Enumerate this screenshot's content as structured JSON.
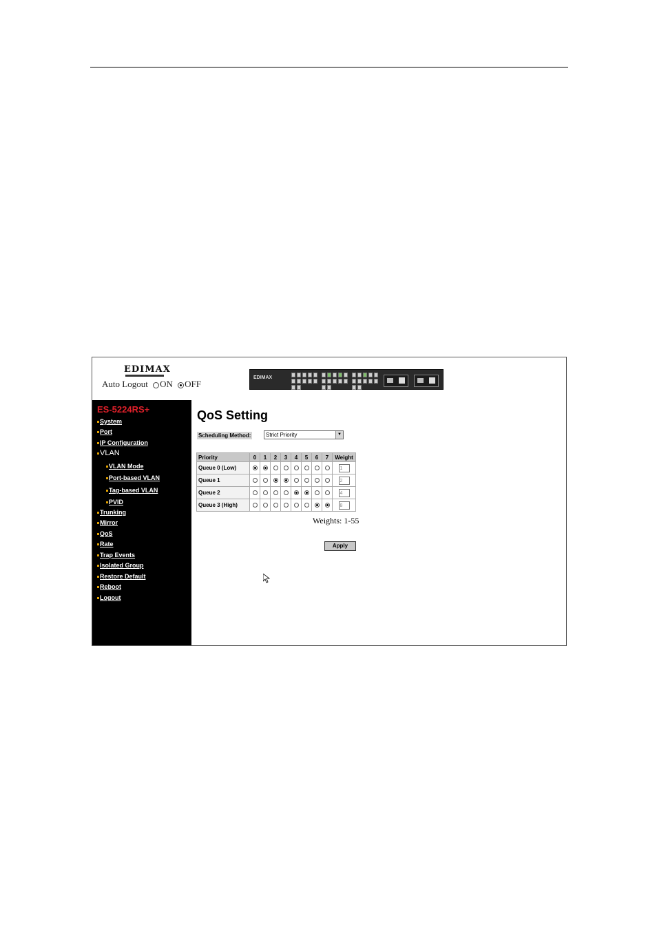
{
  "header": {
    "logo_text": "EDIMAX",
    "auto_logout_label": "Auto Logout",
    "auto_logout_on": "ON",
    "auto_logout_off": "OFF",
    "auto_logout_selected": "OFF",
    "switch_brand": "EDIMAX"
  },
  "sidebar": {
    "model": "ES-5224RS+",
    "items": [
      {
        "label": "System"
      },
      {
        "label": "Port"
      },
      {
        "label": "IP Configuration"
      },
      {
        "label": "VLAN"
      },
      {
        "label": "VLAN Mode"
      },
      {
        "label": "Port-based VLAN"
      },
      {
        "label": "Tag-based VLAN"
      },
      {
        "label": "PVID"
      },
      {
        "label": "Trunking"
      },
      {
        "label": "Mirror"
      },
      {
        "label": "QoS"
      },
      {
        "label": "Rate"
      },
      {
        "label": "Trap Events"
      },
      {
        "label": "Isolated Group"
      },
      {
        "label": "Restore Default"
      },
      {
        "label": "Reboot"
      },
      {
        "label": "Logout"
      }
    ]
  },
  "main": {
    "title": "QoS Setting",
    "scheduling_label": "Scheduling Method:",
    "scheduling_value": "Strict Priority",
    "table": {
      "headers": [
        "Priority",
        "0",
        "1",
        "2",
        "3",
        "4",
        "5",
        "6",
        "7",
        "Weight"
      ],
      "rows": [
        {
          "label": "Queue 0 (Low)",
          "selected": [
            0,
            1
          ],
          "weight": "1"
        },
        {
          "label": "Queue 1",
          "selected": [
            2,
            3
          ],
          "weight": "2"
        },
        {
          "label": "Queue 2",
          "selected": [
            4,
            5
          ],
          "weight": "4"
        },
        {
          "label": "Queue 3 (High)",
          "selected": [
            6,
            7
          ],
          "weight": "8"
        }
      ]
    },
    "weights_note": "Weights: 1-55",
    "apply_label": "Apply"
  }
}
